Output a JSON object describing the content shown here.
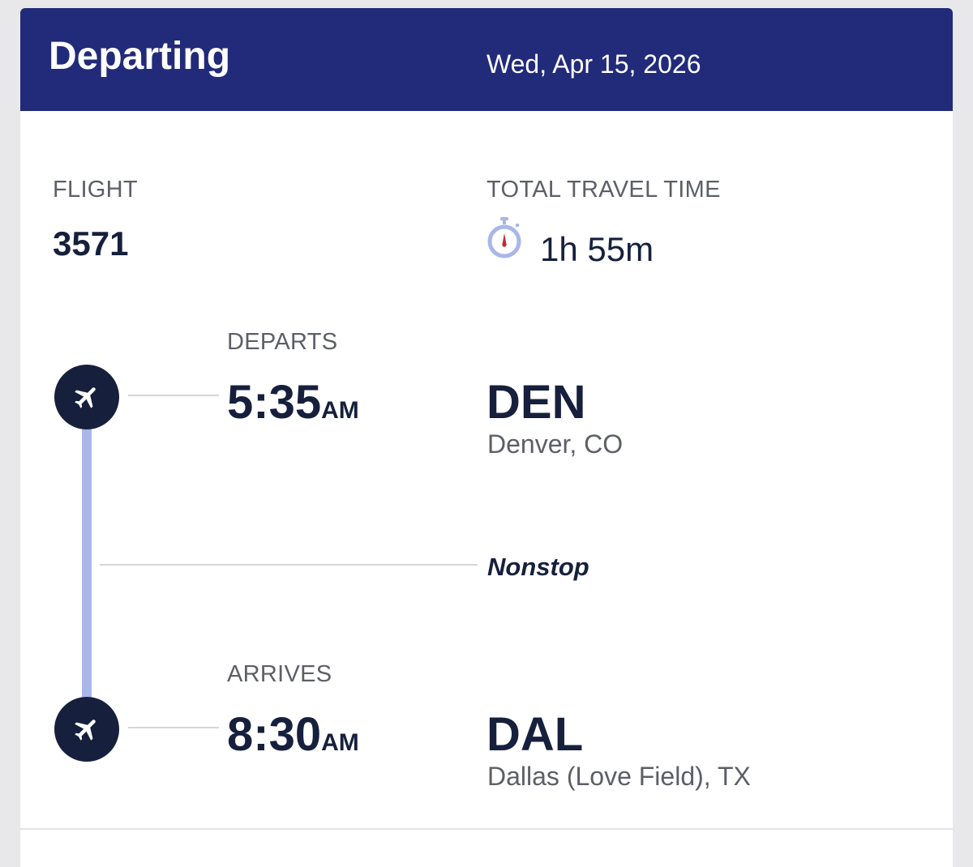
{
  "header": {
    "title": "Departing",
    "date": "Wed, Apr 15, 2026",
    "background_color": "#222a7a"
  },
  "flight": {
    "label": "FLIGHT",
    "number": "3571"
  },
  "travel_time": {
    "label": "TOTAL TRAVEL TIME",
    "icon": "stopwatch-icon",
    "value": "1h 55m"
  },
  "departure": {
    "label": "DEPARTS",
    "time": "5:35",
    "ampm": "AM",
    "airport_code": "DEN",
    "city": "Denver, CO",
    "icon": "plane-icon"
  },
  "stops": {
    "label": "Nonstop"
  },
  "arrival": {
    "label": "ARRIVES",
    "time": "8:30",
    "ampm": "AM",
    "airport_code": "DAL",
    "city": "Dallas (Love Field), TX",
    "icon": "plane-icon"
  },
  "colors": {
    "navy": "#16203d",
    "timeline": "#a9b6ea",
    "muted_text": "#5c5f66"
  }
}
